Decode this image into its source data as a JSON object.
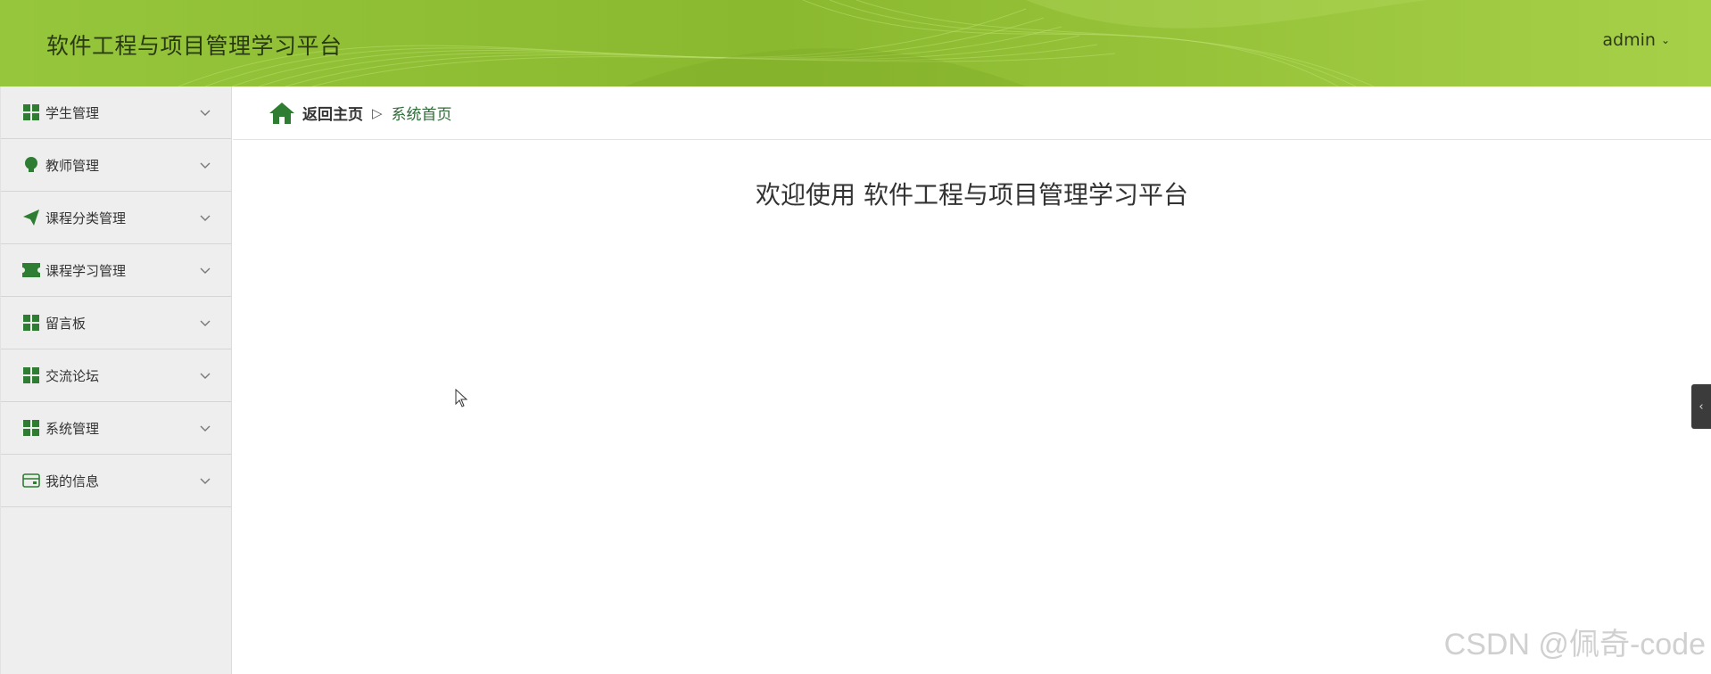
{
  "header": {
    "app_title": "软件工程与项目管理学习平台",
    "user_label": "admin",
    "user_caret": "⌄"
  },
  "sidebar": {
    "items": [
      {
        "label": "学生管理",
        "icon": "grid-icon"
      },
      {
        "label": "教师管理",
        "icon": "lightbulb-icon"
      },
      {
        "label": "课程分类管理",
        "icon": "paper-plane-icon"
      },
      {
        "label": "课程学习管理",
        "icon": "ticket-icon"
      },
      {
        "label": "留言板",
        "icon": "grid-icon"
      },
      {
        "label": "交流论坛",
        "icon": "grid-icon"
      },
      {
        "label": "系统管理",
        "icon": "grid-icon"
      },
      {
        "label": "我的信息",
        "icon": "card-icon"
      }
    ]
  },
  "breadcrumb": {
    "home_label": "返回主页",
    "separator": "▷",
    "current_label": "系统首页"
  },
  "main": {
    "welcome_text": "欢迎使用 软件工程与项目管理学习平台"
  },
  "side_toggle": {
    "glyph": "‹"
  },
  "watermark": "CSDN @佩奇-code",
  "colors": {
    "header_green": "#92c23a",
    "icon_green": "#2e7d32",
    "link_green": "#2e6b37"
  }
}
